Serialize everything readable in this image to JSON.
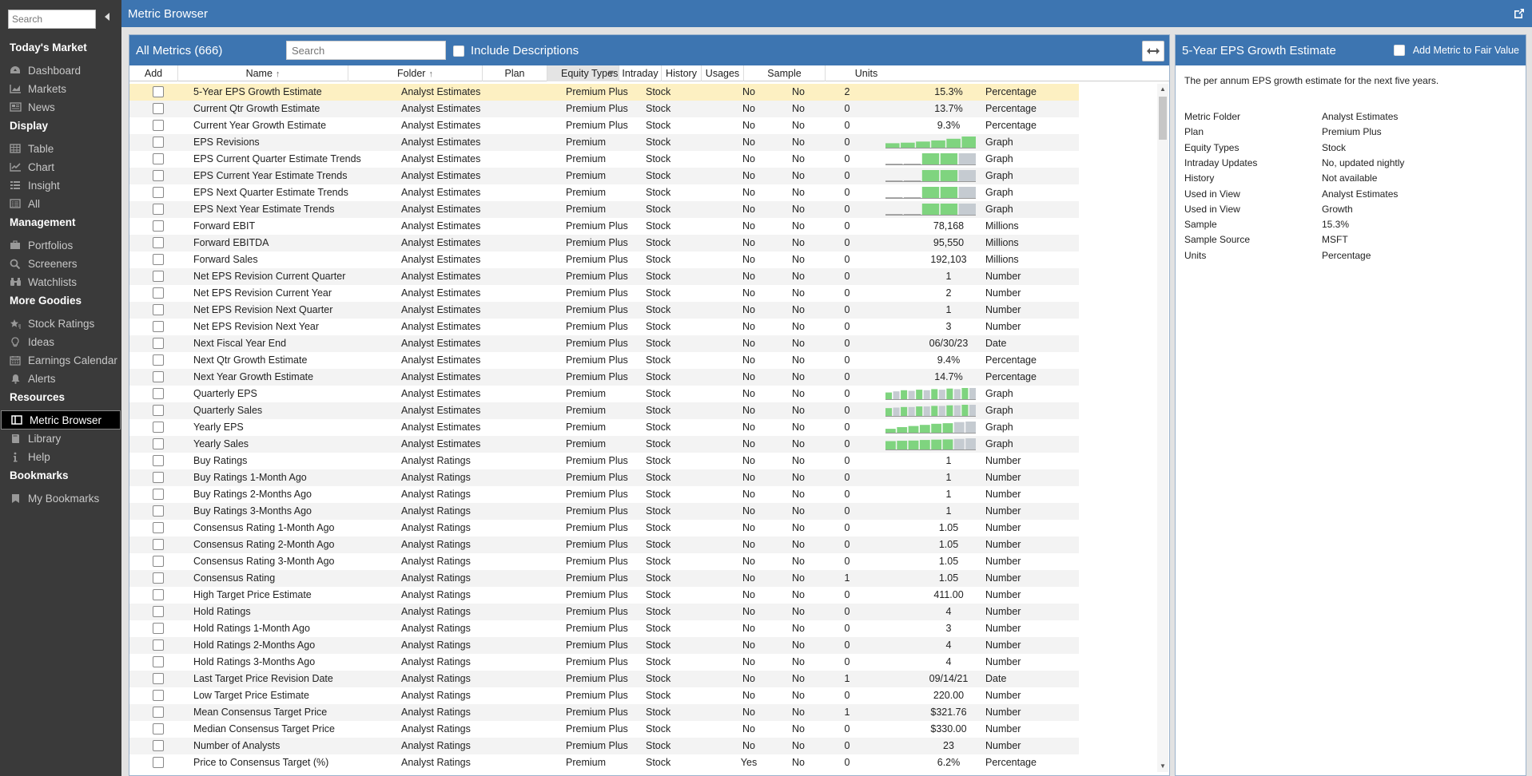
{
  "sidebar": {
    "search_placeholder": "Search",
    "sections": [
      {
        "title": "Today's Market",
        "items": [
          {
            "label": "Dashboard",
            "icon": "dashboard-icon"
          },
          {
            "label": "Markets",
            "icon": "markets-chart-icon"
          },
          {
            "label": "News",
            "icon": "news-icon"
          }
        ]
      },
      {
        "title": "Display",
        "items": [
          {
            "label": "Table",
            "icon": "table-icon"
          },
          {
            "label": "Chart",
            "icon": "line-chart-icon"
          },
          {
            "label": "Insight",
            "icon": "insight-list-icon"
          },
          {
            "label": "All",
            "icon": "all-list-icon"
          }
        ]
      },
      {
        "title": "Management",
        "items": [
          {
            "label": "Portfolios",
            "icon": "briefcase-icon"
          },
          {
            "label": "Screeners",
            "icon": "search-icon"
          },
          {
            "label": "Watchlists",
            "icon": "binoculars-icon"
          }
        ]
      },
      {
        "title": "More Goodies",
        "items": [
          {
            "label": "Stock Ratings",
            "icon": "star-rating-icon"
          },
          {
            "label": "Ideas",
            "icon": "lightbulb-icon"
          },
          {
            "label": "Earnings Calendar",
            "icon": "calendar-icon"
          },
          {
            "label": "Alerts",
            "icon": "bell-icon"
          }
        ]
      },
      {
        "title": "Resources",
        "items": [
          {
            "label": "Metric Browser",
            "icon": "metric-browser-icon",
            "active": true
          },
          {
            "label": "Library",
            "icon": "book-icon"
          },
          {
            "label": "Help",
            "icon": "info-icon"
          }
        ]
      },
      {
        "title": "Bookmarks",
        "items": [
          {
            "label": "My Bookmarks",
            "icon": "bookmark-icon"
          }
        ]
      }
    ]
  },
  "topbar": {
    "title": "Metric Browser"
  },
  "list": {
    "title": "All Metrics (666)",
    "search_placeholder": "Search",
    "include_descriptions_label": "Include Descriptions",
    "columns": [
      "Add",
      "Name",
      "Folder",
      "Plan",
      "Equity Types",
      "Intraday",
      "History",
      "Usages",
      "Sample",
      "Units"
    ],
    "rows": [
      {
        "name": "5-Year EPS Growth Estimate",
        "folder": "Analyst Estimates",
        "plan": "Premium Plus",
        "equity": "Stock",
        "intraday": "No",
        "history": "No",
        "usages": "2",
        "sample": "15.3%",
        "units": "Percentage",
        "selected": true
      },
      {
        "name": "Current Qtr Growth Estimate",
        "folder": "Analyst Estimates",
        "plan": "Premium Plus",
        "equity": "Stock",
        "intraday": "No",
        "history": "No",
        "usages": "0",
        "sample": "13.7%",
        "units": "Percentage"
      },
      {
        "name": "Current Year Growth Estimate",
        "folder": "Analyst Estimates",
        "plan": "Premium Plus",
        "equity": "Stock",
        "intraday": "No",
        "history": "No",
        "usages": "0",
        "sample": "9.3%",
        "units": "Percentage"
      },
      {
        "name": "EPS Revisions",
        "folder": "Analyst Estimates",
        "plan": "Premium",
        "equity": "Stock",
        "intraday": "No",
        "history": "No",
        "usages": "0",
        "sample": "",
        "units": "Graph",
        "graph": {
          "values": [
            0.4,
            0.45,
            0.55,
            0.65,
            0.8,
            1.0
          ],
          "colors": [
            "#7fd47f",
            "#7fd47f",
            "#7fd47f",
            "#7fd47f",
            "#7fd47f",
            "#7fd47f"
          ]
        }
      },
      {
        "name": "EPS Current Quarter Estimate Trends",
        "folder": "Analyst Estimates",
        "plan": "Premium",
        "equity": "Stock",
        "intraday": "No",
        "history": "No",
        "usages": "0",
        "sample": "",
        "units": "Graph",
        "graph": {
          "values": [
            0.02,
            0.02,
            1.0,
            1.0,
            1.0
          ],
          "colors": [
            "#aaa",
            "#aaa",
            "#7fd47f",
            "#7fd47f",
            "#c5cbd1"
          ]
        }
      },
      {
        "name": "EPS Current Year Estimate Trends",
        "folder": "Analyst Estimates",
        "plan": "Premium",
        "equity": "Stock",
        "intraday": "No",
        "history": "No",
        "usages": "0",
        "sample": "",
        "units": "Graph",
        "graph": {
          "values": [
            0.02,
            0.02,
            1.0,
            1.0,
            1.0
          ],
          "colors": [
            "#aaa",
            "#aaa",
            "#7fd47f",
            "#7fd47f",
            "#c5cbd1"
          ]
        }
      },
      {
        "name": "EPS Next Quarter Estimate Trends",
        "folder": "Analyst Estimates",
        "plan": "Premium",
        "equity": "Stock",
        "intraday": "No",
        "history": "No",
        "usages": "0",
        "sample": "",
        "units": "Graph",
        "graph": {
          "values": [
            0.02,
            0.02,
            1.0,
            1.0,
            1.0
          ],
          "colors": [
            "#aaa",
            "#aaa",
            "#7fd47f",
            "#7fd47f",
            "#c5cbd1"
          ]
        }
      },
      {
        "name": "EPS Next Year Estimate Trends",
        "folder": "Analyst Estimates",
        "plan": "Premium",
        "equity": "Stock",
        "intraday": "No",
        "history": "No",
        "usages": "0",
        "sample": "",
        "units": "Graph",
        "graph": {
          "values": [
            0.02,
            0.02,
            1.0,
            1.0,
            1.0
          ],
          "colors": [
            "#aaa",
            "#aaa",
            "#7fd47f",
            "#7fd47f",
            "#c5cbd1"
          ]
        }
      },
      {
        "name": "Forward EBIT",
        "folder": "Analyst Estimates",
        "plan": "Premium Plus",
        "equity": "Stock",
        "intraday": "No",
        "history": "No",
        "usages": "0",
        "sample": "78,168",
        "units": "Millions"
      },
      {
        "name": "Forward EBITDA",
        "folder": "Analyst Estimates",
        "plan": "Premium Plus",
        "equity": "Stock",
        "intraday": "No",
        "history": "No",
        "usages": "0",
        "sample": "95,550",
        "units": "Millions"
      },
      {
        "name": "Forward Sales",
        "folder": "Analyst Estimates",
        "plan": "Premium Plus",
        "equity": "Stock",
        "intraday": "No",
        "history": "No",
        "usages": "0",
        "sample": "192,103",
        "units": "Millions"
      },
      {
        "name": "Net EPS Revision Current Quarter",
        "folder": "Analyst Estimates",
        "plan": "Premium Plus",
        "equity": "Stock",
        "intraday": "No",
        "history": "No",
        "usages": "0",
        "sample": "1",
        "units": "Number"
      },
      {
        "name": "Net EPS Revision Current Year",
        "folder": "Analyst Estimates",
        "plan": "Premium Plus",
        "equity": "Stock",
        "intraday": "No",
        "history": "No",
        "usages": "0",
        "sample": "2",
        "units": "Number"
      },
      {
        "name": "Net EPS Revision Next Quarter",
        "folder": "Analyst Estimates",
        "plan": "Premium Plus",
        "equity": "Stock",
        "intraday": "No",
        "history": "No",
        "usages": "0",
        "sample": "1",
        "units": "Number"
      },
      {
        "name": "Net EPS Revision Next Year",
        "folder": "Analyst Estimates",
        "plan": "Premium Plus",
        "equity": "Stock",
        "intraday": "No",
        "history": "No",
        "usages": "0",
        "sample": "3",
        "units": "Number"
      },
      {
        "name": "Next Fiscal Year End",
        "folder": "Analyst Estimates",
        "plan": "Premium Plus",
        "equity": "Stock",
        "intraday": "No",
        "history": "No",
        "usages": "0",
        "sample": "06/30/23",
        "units": "Date"
      },
      {
        "name": "Next Qtr Growth Estimate",
        "folder": "Analyst Estimates",
        "plan": "Premium Plus",
        "equity": "Stock",
        "intraday": "No",
        "history": "No",
        "usages": "0",
        "sample": "9.4%",
        "units": "Percentage"
      },
      {
        "name": "Next Year Growth Estimate",
        "folder": "Analyst Estimates",
        "plan": "Premium Plus",
        "equity": "Stock",
        "intraday": "No",
        "history": "No",
        "usages": "0",
        "sample": "14.7%",
        "units": "Percentage"
      },
      {
        "name": "Quarterly EPS",
        "folder": "Analyst Estimates",
        "plan": "Premium",
        "equity": "Stock",
        "intraday": "No",
        "history": "No",
        "usages": "0",
        "sample": "",
        "units": "Graph",
        "graph": {
          "values": [
            0.6,
            0.7,
            0.8,
            0.75,
            0.85,
            0.8,
            0.9,
            0.85,
            0.95,
            0.9,
            1.0,
            1.0
          ],
          "colors": [
            "#7fd47f",
            "#c5cbd1",
            "#7fd47f",
            "#c5cbd1",
            "#7fd47f",
            "#c5cbd1",
            "#7fd47f",
            "#c5cbd1",
            "#7fd47f",
            "#c5cbd1",
            "#7fd47f",
            "#c5cbd1"
          ]
        }
      },
      {
        "name": "Quarterly Sales",
        "folder": "Analyst Estimates",
        "plan": "Premium",
        "equity": "Stock",
        "intraday": "No",
        "history": "No",
        "usages": "0",
        "sample": "",
        "units": "Graph",
        "graph": {
          "values": [
            0.7,
            0.75,
            0.8,
            0.8,
            0.85,
            0.85,
            0.9,
            0.9,
            0.95,
            0.95,
            1.0,
            1.0
          ],
          "colors": [
            "#7fd47f",
            "#c5cbd1",
            "#7fd47f",
            "#c5cbd1",
            "#7fd47f",
            "#c5cbd1",
            "#7fd47f",
            "#c5cbd1",
            "#7fd47f",
            "#c5cbd1",
            "#7fd47f",
            "#c5cbd1"
          ]
        }
      },
      {
        "name": "Yearly EPS",
        "folder": "Analyst Estimates",
        "plan": "Premium",
        "equity": "Stock",
        "intraday": "No",
        "history": "No",
        "usages": "0",
        "sample": "",
        "units": "Graph",
        "graph": {
          "values": [
            0.35,
            0.5,
            0.6,
            0.7,
            0.8,
            0.85,
            0.95,
            1.0
          ],
          "colors": [
            "#7fd47f",
            "#7fd47f",
            "#7fd47f",
            "#7fd47f",
            "#7fd47f",
            "#7fd47f",
            "#c5cbd1",
            "#c5cbd1"
          ]
        }
      },
      {
        "name": "Yearly Sales",
        "folder": "Analyst Estimates",
        "plan": "Premium",
        "equity": "Stock",
        "intraday": "No",
        "history": "No",
        "usages": "0",
        "sample": "",
        "units": "Graph",
        "graph": {
          "values": [
            0.75,
            0.78,
            0.8,
            0.85,
            0.88,
            0.9,
            0.95,
            1.0
          ],
          "colors": [
            "#7fd47f",
            "#7fd47f",
            "#7fd47f",
            "#7fd47f",
            "#7fd47f",
            "#7fd47f",
            "#c5cbd1",
            "#c5cbd1"
          ]
        }
      },
      {
        "name": "Buy Ratings",
        "folder": "Analyst Ratings",
        "plan": "Premium Plus",
        "equity": "Stock",
        "intraday": "No",
        "history": "No",
        "usages": "0",
        "sample": "1",
        "units": "Number"
      },
      {
        "name": "Buy Ratings 1-Month Ago",
        "folder": "Analyst Ratings",
        "plan": "Premium Plus",
        "equity": "Stock",
        "intraday": "No",
        "history": "No",
        "usages": "0",
        "sample": "1",
        "units": "Number"
      },
      {
        "name": "Buy Ratings 2-Months Ago",
        "folder": "Analyst Ratings",
        "plan": "Premium Plus",
        "equity": "Stock",
        "intraday": "No",
        "history": "No",
        "usages": "0",
        "sample": "1",
        "units": "Number"
      },
      {
        "name": "Buy Ratings 3-Months Ago",
        "folder": "Analyst Ratings",
        "plan": "Premium Plus",
        "equity": "Stock",
        "intraday": "No",
        "history": "No",
        "usages": "0",
        "sample": "1",
        "units": "Number"
      },
      {
        "name": "Consensus Rating 1-Month Ago",
        "folder": "Analyst Ratings",
        "plan": "Premium Plus",
        "equity": "Stock",
        "intraday": "No",
        "history": "No",
        "usages": "0",
        "sample": "1.05",
        "units": "Number"
      },
      {
        "name": "Consensus Rating 2-Month Ago",
        "folder": "Analyst Ratings",
        "plan": "Premium Plus",
        "equity": "Stock",
        "intraday": "No",
        "history": "No",
        "usages": "0",
        "sample": "1.05",
        "units": "Number"
      },
      {
        "name": "Consensus Rating 3-Month Ago",
        "folder": "Analyst Ratings",
        "plan": "Premium Plus",
        "equity": "Stock",
        "intraday": "No",
        "history": "No",
        "usages": "0",
        "sample": "1.05",
        "units": "Number"
      },
      {
        "name": "Consensus Rating",
        "folder": "Analyst Ratings",
        "plan": "Premium Plus",
        "equity": "Stock",
        "intraday": "No",
        "history": "No",
        "usages": "1",
        "sample": "1.05",
        "units": "Number"
      },
      {
        "name": "High Target Price Estimate",
        "folder": "Analyst Ratings",
        "plan": "Premium Plus",
        "equity": "Stock",
        "intraday": "No",
        "history": "No",
        "usages": "0",
        "sample": "411.00",
        "units": "Number"
      },
      {
        "name": "Hold Ratings",
        "folder": "Analyst Ratings",
        "plan": "Premium Plus",
        "equity": "Stock",
        "intraday": "No",
        "history": "No",
        "usages": "0",
        "sample": "4",
        "units": "Number"
      },
      {
        "name": "Hold Ratings 1-Month Ago",
        "folder": "Analyst Ratings",
        "plan": "Premium Plus",
        "equity": "Stock",
        "intraday": "No",
        "history": "No",
        "usages": "0",
        "sample": "3",
        "units": "Number"
      },
      {
        "name": "Hold Ratings 2-Months Ago",
        "folder": "Analyst Ratings",
        "plan": "Premium Plus",
        "equity": "Stock",
        "intraday": "No",
        "history": "No",
        "usages": "0",
        "sample": "4",
        "units": "Number"
      },
      {
        "name": "Hold Ratings 3-Months Ago",
        "folder": "Analyst Ratings",
        "plan": "Premium Plus",
        "equity": "Stock",
        "intraday": "No",
        "history": "No",
        "usages": "0",
        "sample": "4",
        "units": "Number"
      },
      {
        "name": "Last Target Price Revision Date",
        "folder": "Analyst Ratings",
        "plan": "Premium Plus",
        "equity": "Stock",
        "intraday": "No",
        "history": "No",
        "usages": "1",
        "sample": "09/14/21",
        "units": "Date"
      },
      {
        "name": "Low Target Price Estimate",
        "folder": "Analyst Ratings",
        "plan": "Premium Plus",
        "equity": "Stock",
        "intraday": "No",
        "history": "No",
        "usages": "0",
        "sample": "220.00",
        "units": "Number"
      },
      {
        "name": "Mean Consensus Target Price",
        "folder": "Analyst Ratings",
        "plan": "Premium Plus",
        "equity": "Stock",
        "intraday": "No",
        "history": "No",
        "usages": "1",
        "sample": "$321.76",
        "units": "Number"
      },
      {
        "name": "Median Consensus Target Price",
        "folder": "Analyst Ratings",
        "plan": "Premium Plus",
        "equity": "Stock",
        "intraday": "No",
        "history": "No",
        "usages": "0",
        "sample": "$330.00",
        "units": "Number"
      },
      {
        "name": "Number of Analysts",
        "folder": "Analyst Ratings",
        "plan": "Premium Plus",
        "equity": "Stock",
        "intraday": "No",
        "history": "No",
        "usages": "0",
        "sample": "23",
        "units": "Number"
      },
      {
        "name": "Price to Consensus Target (%)",
        "folder": "Analyst Ratings",
        "plan": "Premium",
        "equity": "Stock",
        "intraday": "Yes",
        "history": "No",
        "usages": "0",
        "sample": "6.2%",
        "units": "Percentage"
      }
    ]
  },
  "detail": {
    "title": "5-Year EPS Growth Estimate",
    "add_label": "Add Metric to Fair Value",
    "description": "The per annum EPS growth estimate for the next five years.",
    "fields": [
      {
        "key": "Metric Folder",
        "value": "Analyst Estimates"
      },
      {
        "key": "Plan",
        "value": "Premium Plus"
      },
      {
        "key": "Equity Types",
        "value": "Stock"
      },
      {
        "key": "Intraday Updates",
        "value": "No, updated nightly"
      },
      {
        "key": "History",
        "value": "Not available"
      },
      {
        "key": "Used in View",
        "value": "Analyst Estimates"
      },
      {
        "key": "Used in View",
        "value": "Growth"
      },
      {
        "key": "Sample",
        "value": "15.3%"
      },
      {
        "key": "Sample Source",
        "value": "MSFT"
      },
      {
        "key": "Units",
        "value": "Percentage"
      }
    ]
  },
  "colors": {
    "brand_blue": "#3d75b1",
    "sidebar_bg": "#3a3a3a",
    "selected_row": "#fdf0c2",
    "graph_green": "#7fd47f",
    "graph_gray": "#c5cbd1"
  }
}
